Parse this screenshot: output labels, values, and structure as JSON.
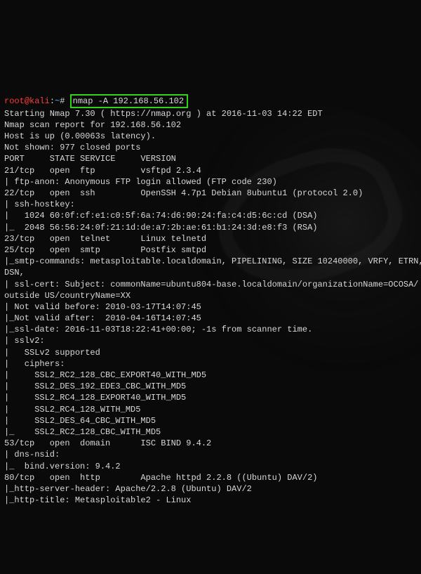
{
  "prompt": {
    "user": "root",
    "at": "@",
    "host": "kali",
    "sep1": ":",
    "path": "~",
    "sep2": "# ",
    "command": "nmap -A 192.168.56.102"
  },
  "lines": [
    "",
    "Starting Nmap 7.30 ( https://nmap.org ) at 2016-11-03 14:22 EDT",
    "Nmap scan report for 192.168.56.102",
    "Host is up (0.00063s latency).",
    "Not shown: 977 closed ports",
    "PORT     STATE SERVICE     VERSION",
    "21/tcp   open  ftp         vsftpd 2.3.4",
    "| ftp-anon: Anonymous FTP login allowed (FTP code 230)",
    "22/tcp   open  ssh         OpenSSH 4.7p1 Debian 8ubuntu1 (protocol 2.0)",
    "| ssh-hostkey:",
    "|   1024 60:0f:cf:e1:c0:5f:6a:74:d6:90:24:fa:c4:d5:6c:cd (DSA)",
    "|_  2048 56:56:24:0f:21:1d:de:a7:2b:ae:61:b1:24:3d:e8:f3 (RSA)",
    "23/tcp   open  telnet      Linux telnetd",
    "25/tcp   open  smtp        Postfix smtpd",
    "|_smtp-commands: metasploitable.localdomain, PIPELINING, SIZE 10240000, VRFY, ETRN,",
    "DSN,",
    "| ssl-cert: Subject: commonName=ubuntu804-base.localdomain/organizationName=OCOSA/",
    "outside US/countryName=XX",
    "| Not valid before: 2010-03-17T14:07:45",
    "|_Not valid after:  2010-04-16T14:07:45",
    "|_ssl-date: 2016-11-03T18:22:41+00:00; -1s from scanner time.",
    "| sslv2:",
    "|   SSLv2 supported",
    "|   ciphers:",
    "|     SSL2_RC2_128_CBC_EXPORT40_WITH_MD5",
    "|     SSL2_DES_192_EDE3_CBC_WITH_MD5",
    "|     SSL2_RC4_128_EXPORT40_WITH_MD5",
    "|     SSL2_RC4_128_WITH_MD5",
    "|     SSL2_DES_64_CBC_WITH_MD5",
    "|_    SSL2_RC2_128_CBC_WITH_MD5",
    "53/tcp   open  domain      ISC BIND 9.4.2",
    "| dns-nsid:",
    "|_  bind.version: 9.4.2",
    "80/tcp   open  http        Apache httpd 2.2.8 ((Ubuntu) DAV/2)",
    "|_http-server-header: Apache/2.2.8 (Ubuntu) DAV/2",
    "|_http-title: Metasploitable2 - Linux"
  ]
}
